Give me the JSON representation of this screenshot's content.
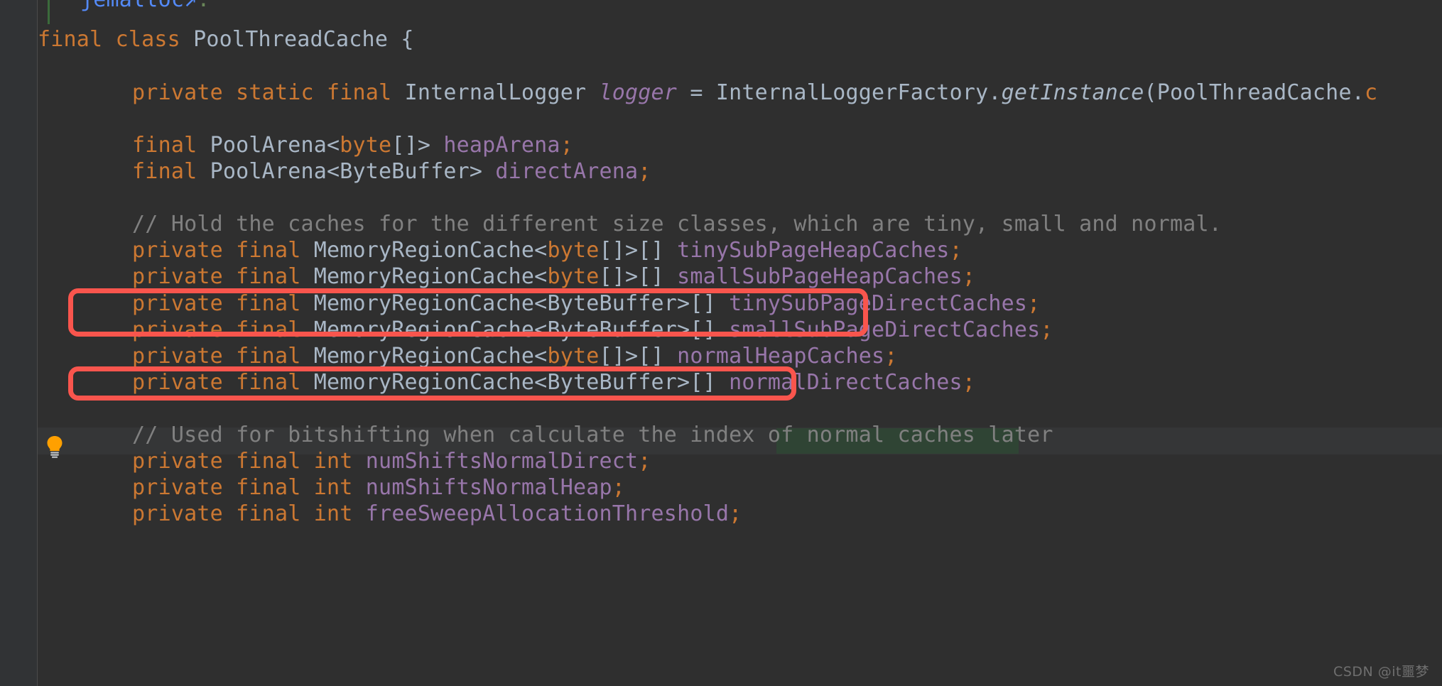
{
  "editor": {
    "background": "#2f2f2f",
    "gutter_background": "#313335",
    "default_text_color": "#a9b7c6",
    "keyword_color": "#cc7832",
    "field_color": "#9876aa",
    "comment_color": "#808080",
    "link_color": "#548af7",
    "annotation_color": "#f9554d",
    "current_line_color": "#353637",
    "identifier_highlight_color": "#2f4434"
  },
  "gutter": {
    "bulb_icon": "lightbulb-icon",
    "bulb_color": "#ffa000"
  },
  "code": {
    "doc_link": {
      "text": "jemalloc",
      "external_arrow": "↗",
      "trailing": "."
    },
    "lines": [
      {
        "id": "class-decl",
        "indent": 0,
        "tokens": [
          {
            "t": "final",
            "c": "kw"
          },
          {
            "t": " ",
            "c": "punc"
          },
          {
            "t": "class",
            "c": "kw"
          },
          {
            "t": " PoolThreadCache {",
            "c": "type"
          }
        ]
      },
      {
        "id": "logger-field",
        "indent": 1,
        "tokens": [
          {
            "t": "private",
            "c": "kw"
          },
          {
            "t": " ",
            "c": "punc"
          },
          {
            "t": "static",
            "c": "kw"
          },
          {
            "t": " ",
            "c": "punc"
          },
          {
            "t": "final",
            "c": "kw"
          },
          {
            "t": " InternalLogger ",
            "c": "type"
          },
          {
            "t": "logger",
            "c": "fielditl"
          },
          {
            "t": " = InternalLoggerFactory.",
            "c": "type"
          },
          {
            "t": "getInstance",
            "c": "static"
          },
          {
            "t": "(PoolThreadCache.",
            "c": "type"
          },
          {
            "t": "c",
            "c": "kw"
          }
        ]
      },
      {
        "id": "heap-arena-field",
        "indent": 1,
        "tokens": [
          {
            "t": "final",
            "c": "kw"
          },
          {
            "t": " PoolArena<",
            "c": "type"
          },
          {
            "t": "byte",
            "c": "kw"
          },
          {
            "t": "[]> ",
            "c": "type"
          },
          {
            "t": "heapArena",
            "c": "field"
          },
          {
            "t": ";",
            "c": "kw"
          }
        ]
      },
      {
        "id": "direct-arena-field",
        "indent": 1,
        "tokens": [
          {
            "t": "final",
            "c": "kw"
          },
          {
            "t": " PoolArena<ByteBuffer> ",
            "c": "type"
          },
          {
            "t": "directArena",
            "c": "field"
          },
          {
            "t": ";",
            "c": "kw"
          }
        ]
      },
      {
        "id": "comment-hold-caches",
        "indent": 1,
        "tokens": [
          {
            "t": "// Hold the caches for the different size classes, which are tiny, small and normal.",
            "c": "comment"
          }
        ]
      },
      {
        "id": "tiny-sub-page-heap-caches",
        "indent": 1,
        "tokens": [
          {
            "t": "private",
            "c": "kw"
          },
          {
            "t": " ",
            "c": "punc"
          },
          {
            "t": "final",
            "c": "kw"
          },
          {
            "t": " MemoryRegionCache<",
            "c": "type"
          },
          {
            "t": "byte",
            "c": "kw"
          },
          {
            "t": "[]>[] ",
            "c": "type"
          },
          {
            "t": "tinySubPageHeapCaches",
            "c": "field"
          },
          {
            "t": ";",
            "c": "kw"
          }
        ]
      },
      {
        "id": "small-sub-page-heap-caches",
        "indent": 1,
        "tokens": [
          {
            "t": "private",
            "c": "kw"
          },
          {
            "t": " ",
            "c": "punc"
          },
          {
            "t": "final",
            "c": "kw"
          },
          {
            "t": " MemoryRegionCache<",
            "c": "type"
          },
          {
            "t": "byte",
            "c": "kw"
          },
          {
            "t": "[]>[] ",
            "c": "type"
          },
          {
            "t": "smallSubPageHeapCaches",
            "c": "field"
          },
          {
            "t": ";",
            "c": "kw"
          }
        ]
      },
      {
        "id": "tiny-sub-page-direct-caches",
        "indent": 1,
        "tokens": [
          {
            "t": "private",
            "c": "kw"
          },
          {
            "t": " ",
            "c": "punc"
          },
          {
            "t": "final",
            "c": "kw"
          },
          {
            "t": " MemoryRegionCache<ByteBuffer>[] ",
            "c": "type"
          },
          {
            "t": "tinySubPageDirectCaches",
            "c": "field"
          },
          {
            "t": ";",
            "c": "kw"
          }
        ]
      },
      {
        "id": "small-sub-page-direct-caches",
        "indent": 1,
        "tokens": [
          {
            "t": "private",
            "c": "kw"
          },
          {
            "t": " ",
            "c": "punc"
          },
          {
            "t": "final",
            "c": "kw"
          },
          {
            "t": " MemoryRegionCache<ByteBuffer>[] ",
            "c": "type"
          },
          {
            "t": "smallSubPageDirectCaches",
            "c": "field"
          },
          {
            "t": ";",
            "c": "kw"
          }
        ]
      },
      {
        "id": "normal-heap-caches",
        "indent": 1,
        "tokens": [
          {
            "t": "private",
            "c": "kw"
          },
          {
            "t": " ",
            "c": "punc"
          },
          {
            "t": "final",
            "c": "kw"
          },
          {
            "t": " MemoryRegionCache<",
            "c": "type"
          },
          {
            "t": "byte",
            "c": "kw"
          },
          {
            "t": "[]>[] ",
            "c": "type"
          },
          {
            "t": "normalHeapCaches",
            "c": "field"
          },
          {
            "t": ";",
            "c": "kw"
          }
        ]
      },
      {
        "id": "normal-direct-caches",
        "indent": 1,
        "tokens": [
          {
            "t": "private",
            "c": "kw"
          },
          {
            "t": " ",
            "c": "punc"
          },
          {
            "t": "final",
            "c": "kw"
          },
          {
            "t": " MemoryRegionCache<ByteBuffer>[] ",
            "c": "type"
          },
          {
            "t": "normalDirectCaches",
            "c": "field"
          },
          {
            "t": ";",
            "c": "kw"
          }
        ]
      },
      {
        "id": "comment-bitshifting",
        "indent": 1,
        "tokens": [
          {
            "t": "// Used for bitshifting when calculate the index of normal caches later",
            "c": "comment"
          }
        ]
      },
      {
        "id": "num-shifts-normal-direct",
        "indent": 1,
        "tokens": [
          {
            "t": "private",
            "c": "kw"
          },
          {
            "t": " ",
            "c": "punc"
          },
          {
            "t": "final",
            "c": "kw"
          },
          {
            "t": " ",
            "c": "punc"
          },
          {
            "t": "int",
            "c": "kw"
          },
          {
            "t": " ",
            "c": "punc"
          },
          {
            "t": "numShiftsNormalDirect",
            "c": "field"
          },
          {
            "t": ";",
            "c": "kw"
          }
        ]
      },
      {
        "id": "num-shifts-normal-heap",
        "indent": 1,
        "tokens": [
          {
            "t": "private",
            "c": "kw"
          },
          {
            "t": " ",
            "c": "punc"
          },
          {
            "t": "final",
            "c": "kw"
          },
          {
            "t": " ",
            "c": "punc"
          },
          {
            "t": "int",
            "c": "kw"
          },
          {
            "t": " ",
            "c": "punc"
          },
          {
            "t": "numShiftsNormalHeap",
            "c": "field"
          },
          {
            "t": ";",
            "c": "kw"
          }
        ]
      },
      {
        "id": "free-sweep-allocation-threshold",
        "indent": 1,
        "tokens": [
          {
            "t": "private",
            "c": "kw"
          },
          {
            "t": " ",
            "c": "punc"
          },
          {
            "t": "final",
            "c": "kw"
          },
          {
            "t": " ",
            "c": "punc"
          },
          {
            "t": "int",
            "c": "kw"
          },
          {
            "t": " ",
            "c": "punc"
          },
          {
            "t": "freeSweepAllocationThreshold",
            "c": "field"
          },
          {
            "t": ";",
            "c": "kw"
          }
        ]
      }
    ]
  },
  "annotations": [
    {
      "id": "red-box-direct-caches-pair",
      "label": "tinySubPageDirectCaches / smallSubPageDirectCaches"
    },
    {
      "id": "red-box-normal-direct-caches",
      "label": "normalDirectCaches"
    }
  ],
  "watermark": {
    "text": "CSDN @it噩梦"
  }
}
